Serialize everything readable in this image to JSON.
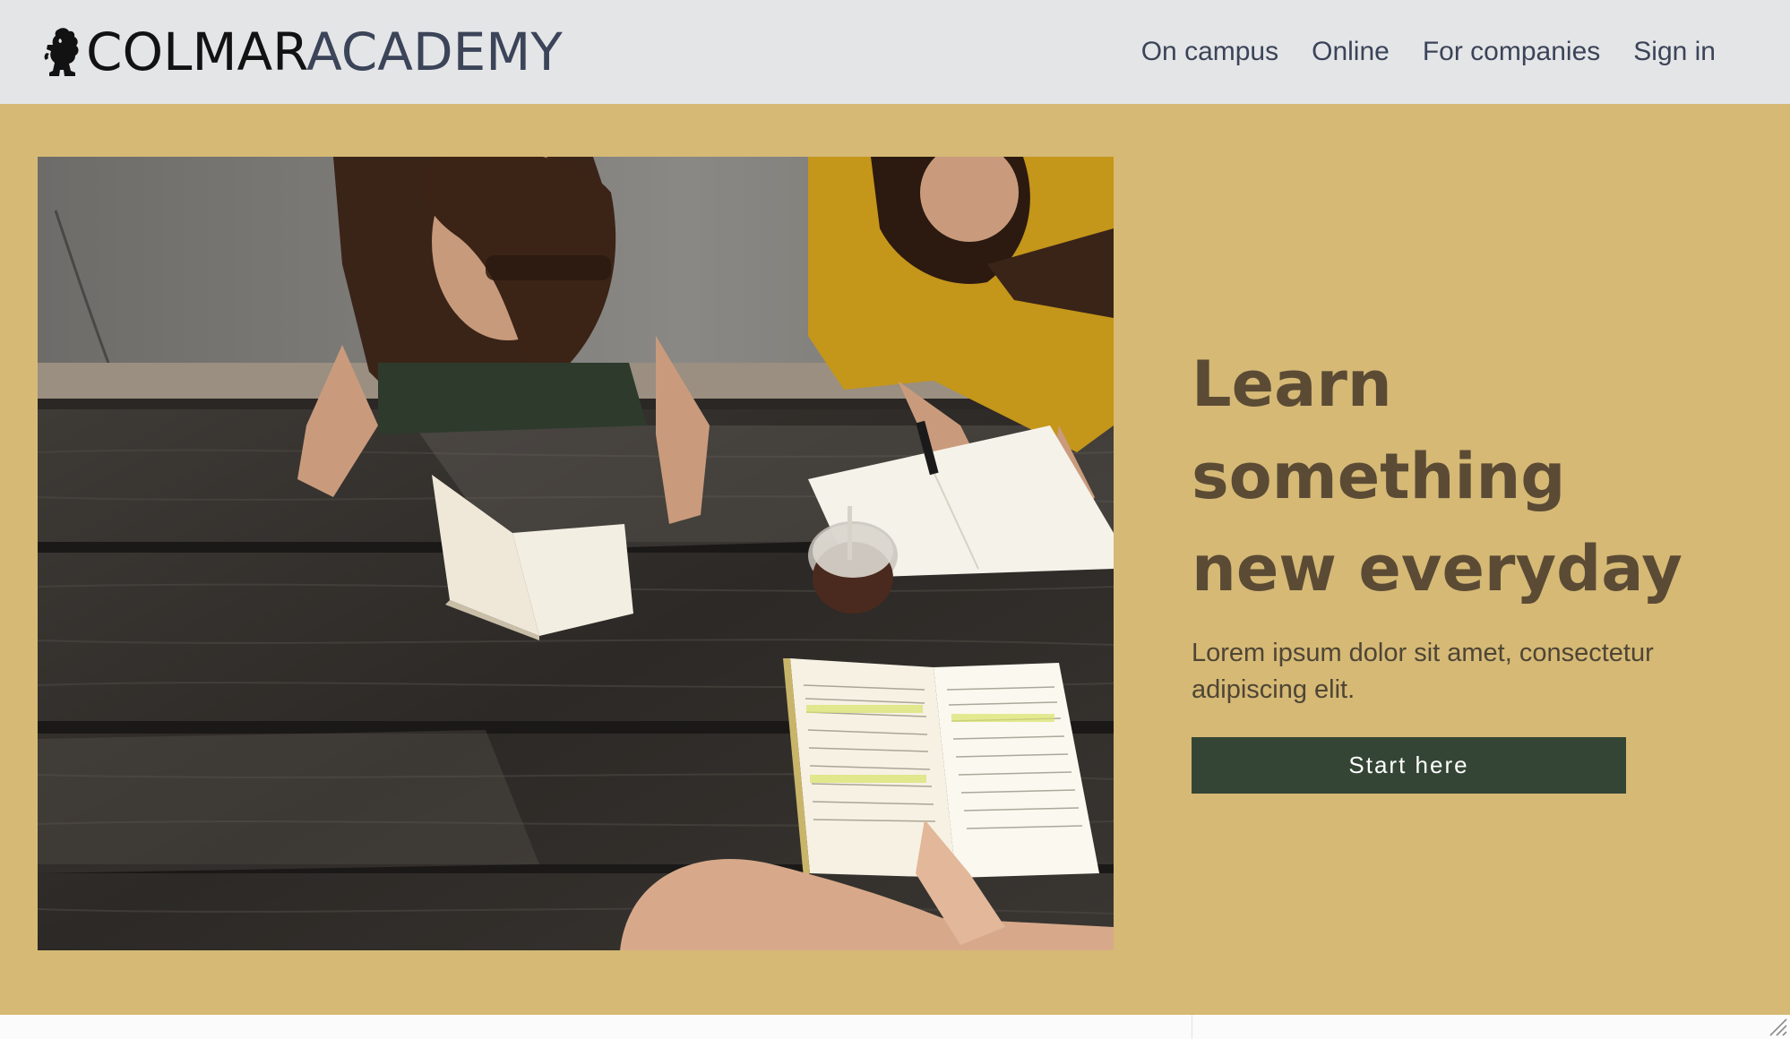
{
  "header": {
    "brand": {
      "strong": "COLMAR",
      "light": "ACADEMY",
      "logo_icon": "lion-rampant-icon"
    },
    "nav": [
      {
        "label": "On campus"
      },
      {
        "label": "Online"
      },
      {
        "label": "For companies"
      },
      {
        "label": "Sign in"
      }
    ]
  },
  "hero": {
    "title_lines": [
      "Learn",
      "something",
      "new everyday"
    ],
    "subtitle": "Lorem ipsum dolor sit amet, consectetur adipiscing elit.",
    "cta_label": "Start here",
    "image_icon": "students-reading-photo"
  },
  "colors": {
    "header_bg": "#e4e5e7",
    "hero_bg": "#d5b975",
    "title": "#5b4b35",
    "cta_bg": "#354535",
    "nav_text": "#3b4458"
  }
}
